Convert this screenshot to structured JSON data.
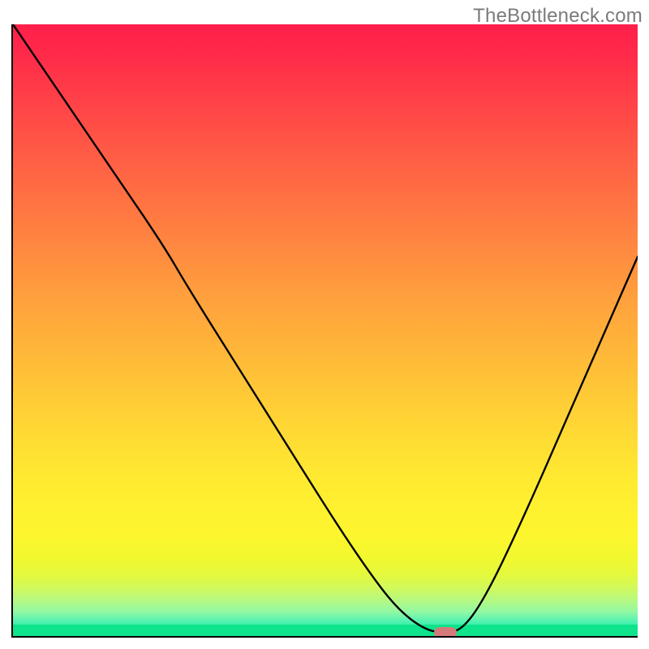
{
  "attribution": "TheBottleneck.com",
  "chart_data": {
    "type": "line",
    "title": "",
    "xlabel": "",
    "ylabel": "",
    "xlim": [
      0,
      100
    ],
    "ylim": [
      0,
      100
    ],
    "axes_shown": {
      "left": true,
      "bottom": true,
      "right": false,
      "top": false
    },
    "ticks_shown": false,
    "series": [
      {
        "name": "bottleneck-curve",
        "x": [
          0,
          8,
          16,
          24,
          28,
          36,
          44,
          52,
          58,
          62,
          66,
          69,
          72,
          76,
          82,
          88,
          94,
          100
        ],
        "y": [
          100,
          88,
          76,
          64,
          57,
          44,
          31,
          18,
          9,
          4,
          1,
          0.5,
          1,
          7,
          20,
          34,
          48,
          62
        ]
      }
    ],
    "annotations": [
      {
        "name": "optimal-indicator",
        "x": 69,
        "y": 0.8,
        "shape": "rounded-rect",
        "color": "#d47a7a"
      }
    ],
    "background_gradient": {
      "direction": "top-to-bottom",
      "stops": [
        {
          "pos": 0.0,
          "color": "#ff1f4a"
        },
        {
          "pos": 0.4,
          "color": "#ff933f"
        },
        {
          "pos": 0.8,
          "color": "#fff22f"
        },
        {
          "pos": 0.97,
          "color": "#57f3b2"
        },
        {
          "pos": 1.0,
          "color": "#0de48b"
        }
      ]
    }
  }
}
